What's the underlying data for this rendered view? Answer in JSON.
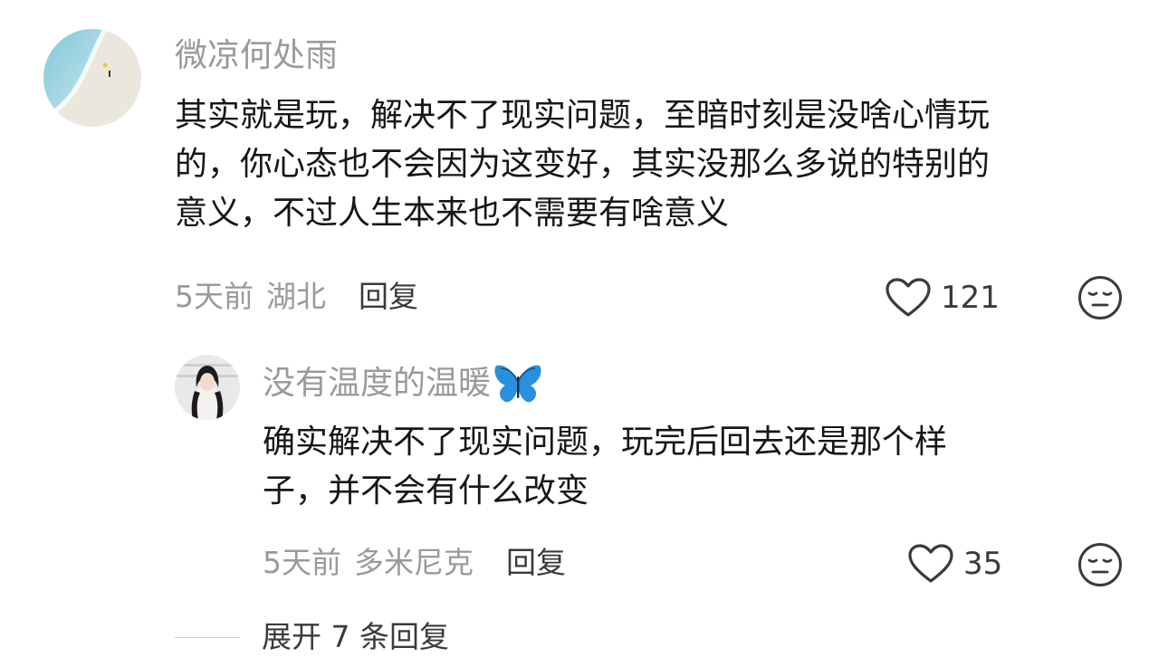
{
  "comment": {
    "username": "微凉何处雨",
    "content_lines": [
      "其实就是玩，解决不了现实问题，至暗时刻是没啥心情玩",
      "的，你心态也不会因为这变好，其实没那么多说的特别的",
      "意义，不过人生本来也不需要有啥意义"
    ],
    "time": "5天前",
    "location": "湖北",
    "reply_label": "回复",
    "like_count": "121",
    "like_icon": "heart-outline-icon",
    "reaction_icon": "expressionless-face-icon"
  },
  "reply": {
    "username": "没有温度的温暖",
    "badge_icon": "butterfly-icon",
    "content_lines": [
      "确实解决不了现实问题，玩完后回去还是那个样",
      "子，并不会有什么改变"
    ],
    "time": "5天前",
    "location": "多米尼克",
    "reply_label": "回复",
    "like_count": "35",
    "like_icon": "heart-outline-icon",
    "reaction_icon": "expressionless-face-icon"
  },
  "expand": {
    "label": "展开 7 条回复"
  },
  "colors": {
    "muted_text": "#9a9a9a",
    "body_text": "#161616",
    "action_text": "#3a3a3a",
    "butterfly": "#2a8fdc"
  }
}
